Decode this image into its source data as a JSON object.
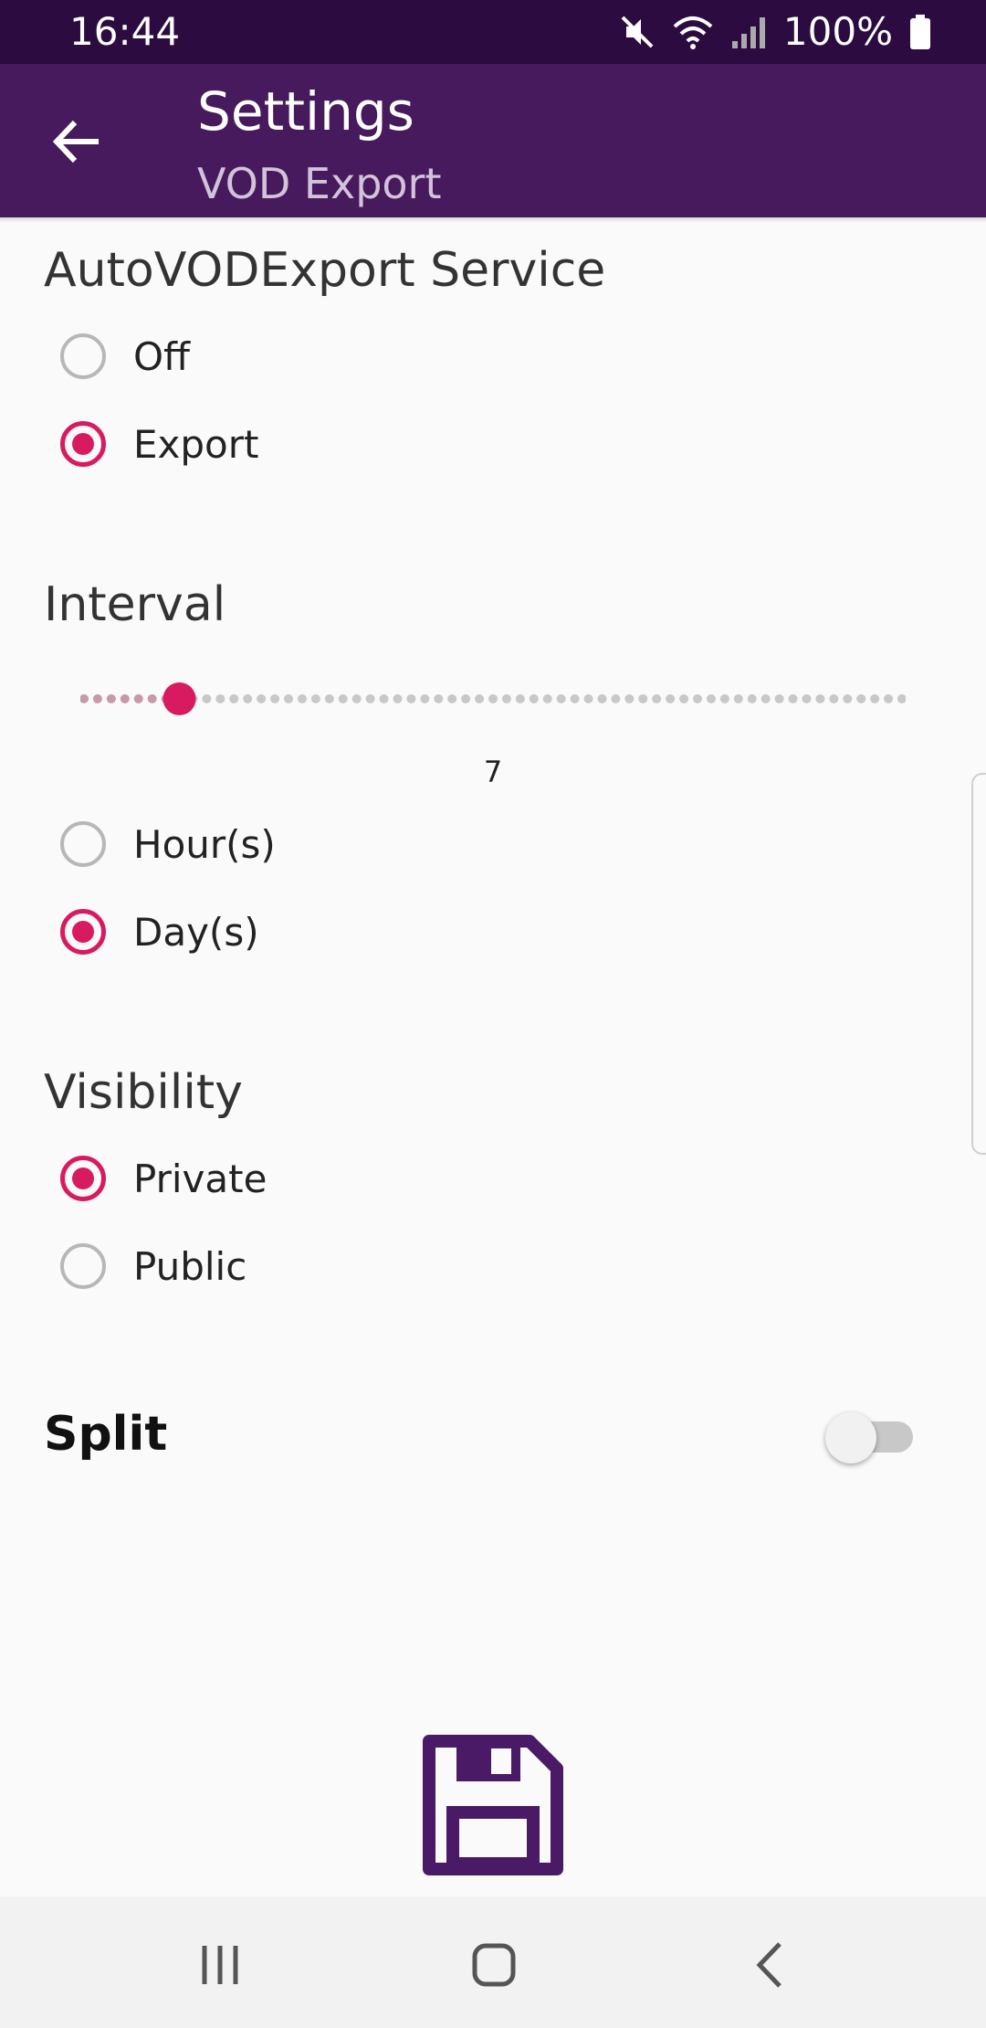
{
  "status_bar": {
    "time": "16:44",
    "battery": "100%"
  },
  "app_bar": {
    "title": "Settings",
    "subtitle": "VOD Export"
  },
  "service": {
    "title": "AutoVODExport Service",
    "options": [
      {
        "label": "Off",
        "checked": false
      },
      {
        "label": "Export",
        "checked": true
      }
    ]
  },
  "interval": {
    "title": "Interval",
    "value": "7",
    "slider_min": 0,
    "slider_max": 60,
    "unit_options": [
      {
        "label": "Hour(s)",
        "checked": false
      },
      {
        "label": "Day(s)",
        "checked": true
      }
    ]
  },
  "visibility": {
    "title": "Visibility",
    "options": [
      {
        "label": "Private",
        "checked": true
      },
      {
        "label": "Public",
        "checked": false
      }
    ]
  },
  "split": {
    "label": "Split",
    "enabled": false
  },
  "colors": {
    "accent": "#d81b60",
    "primary": "#461a5c",
    "status_bar": "#2c0c40",
    "save_icon": "#4a1a66"
  },
  "icons": {
    "back": "arrow-left-icon",
    "save": "floppy-disk-icon",
    "nav_recents": "recents-icon",
    "nav_home": "home-icon",
    "nav_back": "chevron-left-icon"
  }
}
